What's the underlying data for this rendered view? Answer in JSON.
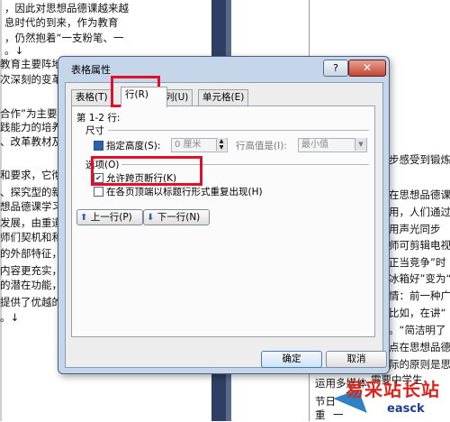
{
  "document": {
    "left_lines": [
      "，因此对思想品德课越来越",
      "息时代的到来，作为教育",
      "，仍然抱着“一支粉笔、一",
      "。↓",
      "教育主要阵地",
      "次深刻的变革",
      "合作”为主要",
      "践能力的培养",
      "、改革教材及",
      "和要求，它彻",
      "、探究型的新",
      "想品德课学习",
      "发展，由重道",
      "师们契机和和",
      "的外部特征，",
      "内容更充实，",
      "的潜在功能，",
      "提供了优越的",
      "。↓"
    ],
    "right_lines": [
      "步感受到锻炼",
      "在思想品德课堂",
      "用，人们通过",
      "用声光同步",
      "师可剪辑电视",
      "正当竞争”时",
      "冰箱好”变为“",
      "情：前一种广",
      "比如，在讲“",
      "。“简洁明了",
      "点在思想品德",
      "际的原则是思",
      "需要中学生",
      "运用多媒体",
      "节日",
      "重",
      "一"
    ]
  },
  "dialog": {
    "title": "表格属性",
    "help_label": "?",
    "close_label": "✕",
    "tabs": [
      {
        "label": "表格(T)"
      },
      {
        "label": "行(R)"
      },
      {
        "label": "列(U)"
      },
      {
        "label": "单元格(E)"
      }
    ],
    "row_range_label": "第 1-2 行:",
    "size_section_label": "尺寸",
    "specify_height_label": "指定高度(S):",
    "height_value": "0 厘米",
    "height_rule_label": "行高值是(I):",
    "height_rule_value": "最小值",
    "options_section_label": "选项(O)",
    "allow_break_label": "允许跨页断行(K)",
    "repeat_header_label": "在各页顶端以标题行形式重复出现(H)",
    "prev_row_label": "上一行(P)",
    "next_row_label": "下一行(N)",
    "ok_label": "确定",
    "cancel_label": "取消"
  },
  "watermark": {
    "text": "易采站长站",
    "url": "easck"
  },
  "colors": {
    "highlight": "#e0102a",
    "dialog_frame": "#c6d6ea",
    "close_button": "#c24633"
  }
}
